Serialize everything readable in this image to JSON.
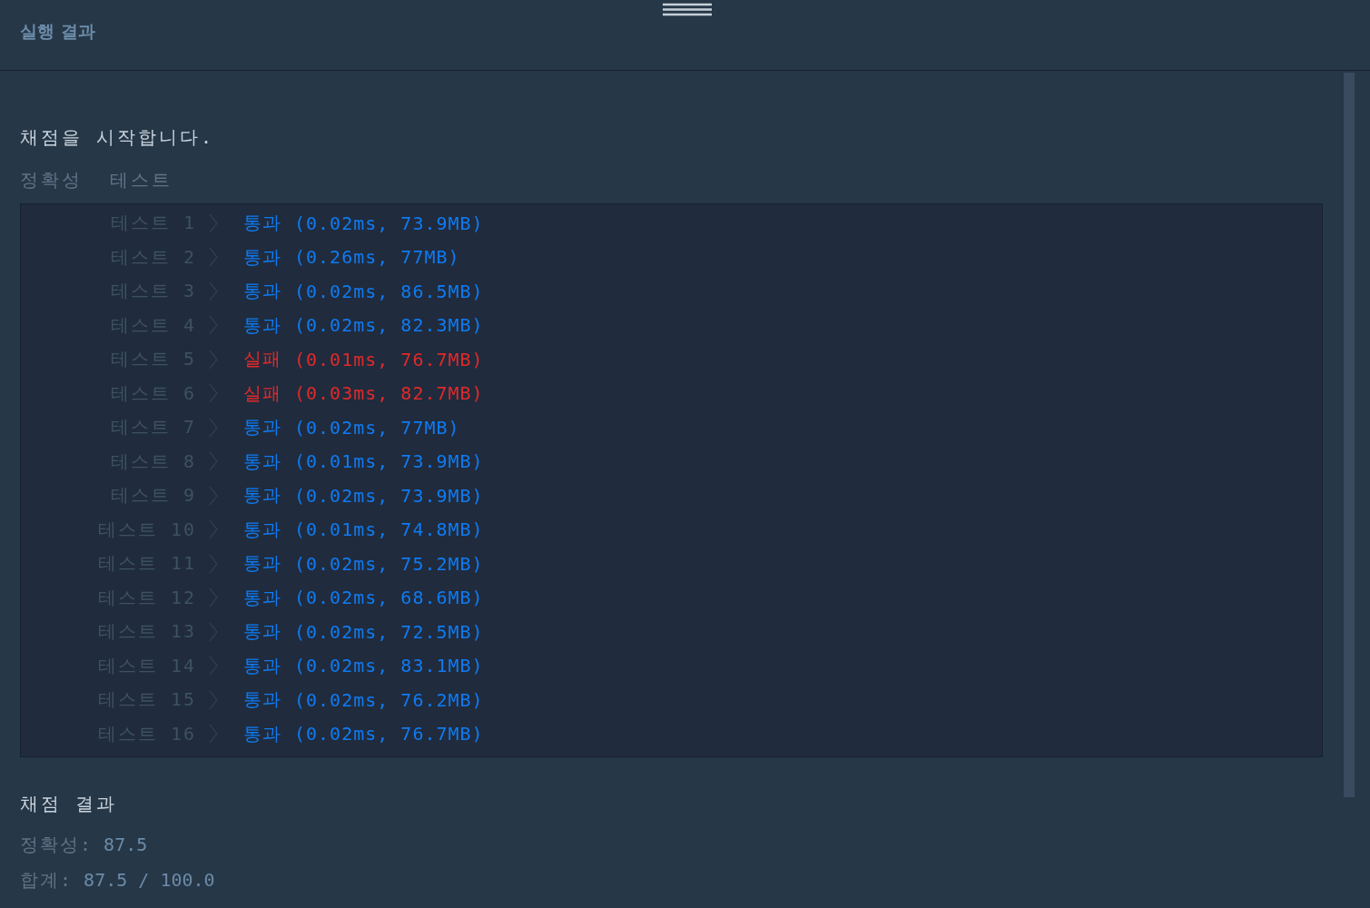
{
  "panel": {
    "title": "실행 결과"
  },
  "output": {
    "start_message": "채점을 시작합니다.",
    "section_label": "정확성  테스트",
    "tests": [
      {
        "label": "테스트 1",
        "kind": "pass",
        "status": "통과",
        "detail": "(0.02ms, 73.9MB)"
      },
      {
        "label": "테스트 2",
        "kind": "pass",
        "status": "통과",
        "detail": "(0.26ms, 77MB)"
      },
      {
        "label": "테스트 3",
        "kind": "pass",
        "status": "통과",
        "detail": "(0.02ms, 86.5MB)"
      },
      {
        "label": "테스트 4",
        "kind": "pass",
        "status": "통과",
        "detail": "(0.02ms, 82.3MB)"
      },
      {
        "label": "테스트 5",
        "kind": "fail",
        "status": "실패",
        "detail": "(0.01ms, 76.7MB)"
      },
      {
        "label": "테스트 6",
        "kind": "fail",
        "status": "실패",
        "detail": "(0.03ms, 82.7MB)"
      },
      {
        "label": "테스트 7",
        "kind": "pass",
        "status": "통과",
        "detail": "(0.02ms, 77MB)"
      },
      {
        "label": "테스트 8",
        "kind": "pass",
        "status": "통과",
        "detail": "(0.01ms, 73.9MB)"
      },
      {
        "label": "테스트 9",
        "kind": "pass",
        "status": "통과",
        "detail": "(0.02ms, 73.9MB)"
      },
      {
        "label": "테스트 10",
        "kind": "pass",
        "status": "통과",
        "detail": "(0.01ms, 74.8MB)"
      },
      {
        "label": "테스트 11",
        "kind": "pass",
        "status": "통과",
        "detail": "(0.02ms, 75.2MB)"
      },
      {
        "label": "테스트 12",
        "kind": "pass",
        "status": "통과",
        "detail": "(0.02ms, 68.6MB)"
      },
      {
        "label": "테스트 13",
        "kind": "pass",
        "status": "통과",
        "detail": "(0.02ms, 72.5MB)"
      },
      {
        "label": "테스트 14",
        "kind": "pass",
        "status": "통과",
        "detail": "(0.02ms, 83.1MB)"
      },
      {
        "label": "테스트 15",
        "kind": "pass",
        "status": "통과",
        "detail": "(0.02ms, 76.2MB)"
      },
      {
        "label": "테스트 16",
        "kind": "pass",
        "status": "통과",
        "detail": "(0.02ms, 76.7MB)"
      }
    ],
    "result_heading": "채점 결과",
    "accuracy": {
      "label": "정확성:",
      "value": "87.5"
    },
    "total": {
      "label": "합계:",
      "value": "87.5 / 100.0"
    }
  }
}
